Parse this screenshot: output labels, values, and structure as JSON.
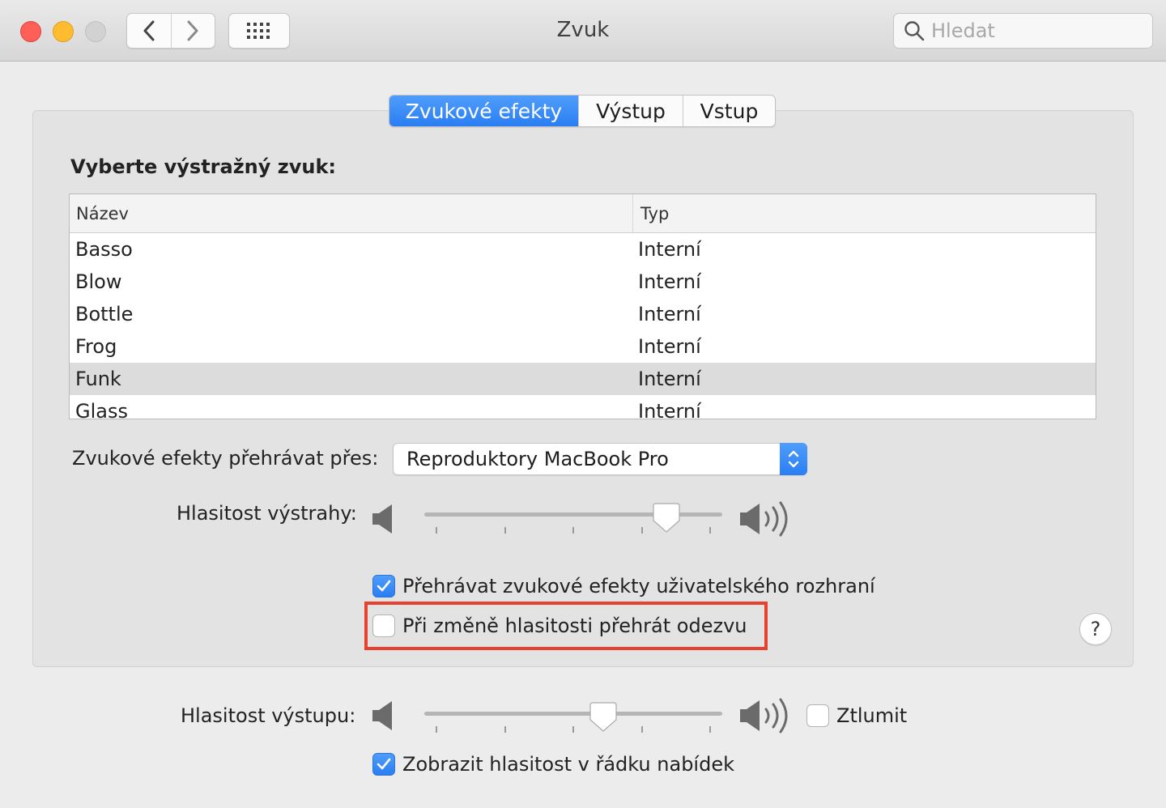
{
  "window": {
    "title": "Zvuk"
  },
  "search": {
    "placeholder": "Hledat"
  },
  "tabs": [
    {
      "label": "Zvukové efekty",
      "active": true
    },
    {
      "label": "Výstup",
      "active": false
    },
    {
      "label": "Vstup",
      "active": false
    }
  ],
  "alerts": {
    "title": "Vyberte výstražný zvuk:",
    "columns": {
      "name": "Název",
      "type": "Typ"
    },
    "rows": [
      {
        "name": "Basso",
        "type": "Interní"
      },
      {
        "name": "Blow",
        "type": "Interní"
      },
      {
        "name": "Bottle",
        "type": "Interní"
      },
      {
        "name": "Frog",
        "type": "Interní"
      },
      {
        "name": "Funk",
        "type": "Interní",
        "selected": true
      },
      {
        "name": "Glass",
        "type": "Interní"
      }
    ],
    "selected": "Funk"
  },
  "play_through": {
    "label": "Zvukové efekty přehrávat přes:",
    "value": "Reproduktory MacBook Pro"
  },
  "alert_volume": {
    "label": "Hlasitost výstrahy:",
    "level": 0.84
  },
  "options": {
    "ui_sounds": {
      "label": "Přehrávat zvukové efekty uživatelského rozhraní",
      "checked": true
    },
    "volume_feedback": {
      "label": "Při změně hlasitosti přehrát odezvu",
      "checked": false
    }
  },
  "help": {
    "label": "?"
  },
  "output_volume": {
    "label": "Hlasitost výstupu:",
    "level": 0.61,
    "mute": {
      "label": "Ztlumit",
      "checked": false
    }
  },
  "menu_bar": {
    "label": "Zobrazit hlasitost v řádku nabídek",
    "checked": true
  },
  "colors": {
    "accent": "#2a7ef2",
    "highlight_frame": "#e8422f",
    "close": "#fe5f57",
    "minimize": "#febc2e",
    "maximize_disabled": "#d2d2d2"
  },
  "icons": [
    "back-chevron-icon",
    "forward-chevron-icon",
    "grid-icon",
    "search-icon",
    "popup-stepper-icon",
    "speaker-low-icon",
    "speaker-high-icon",
    "checkmark-icon"
  ]
}
